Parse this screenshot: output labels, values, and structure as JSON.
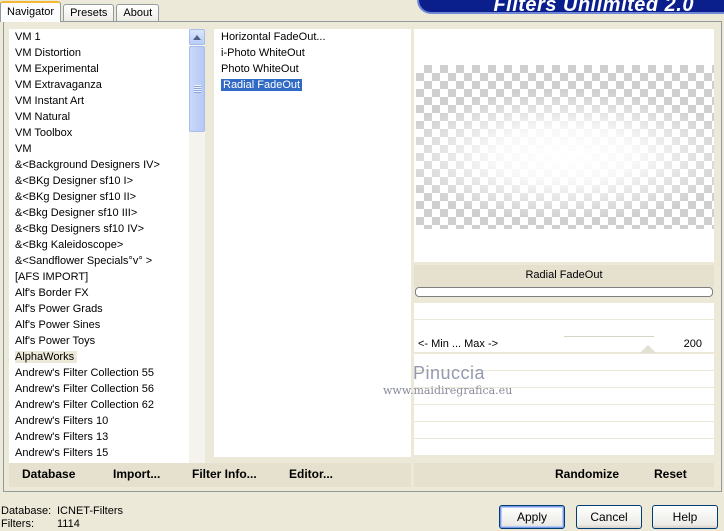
{
  "tabs": [
    "Navigator",
    "Presets",
    "About"
  ],
  "logo_text": "Filters Unlimited 2.0",
  "categories": [
    "VM 1",
    "VM Distortion",
    "VM Experimental",
    "VM Extravaganza",
    "VM Instant Art",
    "VM Natural",
    "VM Toolbox",
    "VM",
    "&<Background Designers IV>",
    "&<BKg Designer sf10 I>",
    "&<BKg Designer sf10 II>",
    "&<Bkg Designer sf10 III>",
    "&<Bkg Designers sf10 IV>",
    "&<Bkg Kaleidoscope>",
    "&<Sandflower Specials°v° >",
    "[AFS IMPORT]",
    "Alf's Border FX",
    "Alf's Power Grads",
    "Alf's Power Sines",
    "Alf's Power Toys",
    "AlphaWorks",
    "Andrew's Filter Collection 55",
    "Andrew's Filter Collection 56",
    "Andrew's Filter Collection 62",
    "Andrew's Filters 10",
    "Andrew's Filters 13",
    "Andrew's Filters 15"
  ],
  "selected_category": "AlphaWorks",
  "filters": [
    "Horizontal FadeOut...",
    "i-Photo WhiteOut",
    "Photo WhiteOut",
    "Radial FadeOut"
  ],
  "selected_filter": "Radial FadeOut",
  "filter_title": "Radial FadeOut",
  "slider": {
    "label": "<- Min ... Max ->",
    "value": "200"
  },
  "watermark": {
    "name": "Pinuccia",
    "url": "www.maidiregrafica.eu"
  },
  "toolbar_left": [
    "Database",
    "Import...",
    "Filter Info...",
    "Editor..."
  ],
  "toolbar_right": [
    "Randomize",
    "Reset"
  ],
  "status": {
    "database_label": "Database:",
    "database_value": "ICNET-Filters",
    "filters_label": "Filters:",
    "filters_value": "1114"
  },
  "buttons": {
    "apply": "Apply",
    "cancel": "Cancel",
    "help": "Help"
  },
  "icons": [
    "scroll-up-arrow-icon",
    "scroll-down-arrow-icon",
    "scroll-grip-icon"
  ]
}
